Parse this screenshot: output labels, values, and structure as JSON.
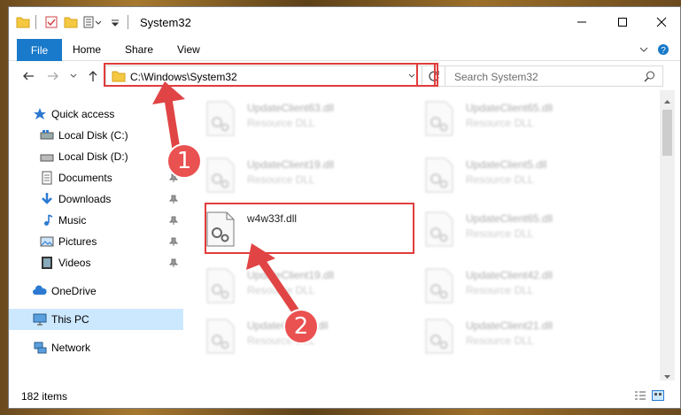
{
  "window": {
    "title": "System32",
    "minimize_icon": "minimize-icon",
    "maximize_icon": "maximize-icon",
    "close_icon": "close-icon"
  },
  "ribbon": {
    "tabs": [
      "File",
      "Home",
      "Share",
      "View"
    ],
    "collapse_icon": "chevron-down-icon",
    "help_icon": "help-icon"
  },
  "address": {
    "path": "C:\\Windows\\System32",
    "dropdown_icon": "chevron-down-icon",
    "refresh_icon": "refresh-icon"
  },
  "search": {
    "placeholder": "Search System32",
    "icon": "search-icon"
  },
  "nav": {
    "items": [
      {
        "label": "Quick access",
        "icon": "star-icon",
        "pinned": false
      },
      {
        "label": "Local Disk (C:)",
        "icon": "drive-icon",
        "pinned": false
      },
      {
        "label": "Local Disk (D:)",
        "icon": "drive-icon",
        "pinned": false
      },
      {
        "label": "Documents",
        "icon": "documents-icon",
        "pinned": true
      },
      {
        "label": "Downloads",
        "icon": "download-icon",
        "pinned": true
      },
      {
        "label": "Music",
        "icon": "music-icon",
        "pinned": true
      },
      {
        "label": "Pictures",
        "icon": "pictures-icon",
        "pinned": true
      },
      {
        "label": "Videos",
        "icon": "videos-icon",
        "pinned": true
      },
      {
        "label": "OneDrive",
        "icon": "cloud-icon",
        "pinned": false
      },
      {
        "label": "This PC",
        "icon": "computer-icon",
        "pinned": false,
        "selected": true
      },
      {
        "label": "Network",
        "icon": "network-icon",
        "pinned": false
      }
    ]
  },
  "files": [
    {
      "name": "UpdateClient63.dll",
      "type": "Resource DLL"
    },
    {
      "name": "UpdateClient65.dll",
      "type": "Resource DLL"
    },
    {
      "name": "UpdateClient19.dll",
      "type": "Resource DLL"
    },
    {
      "name": "UpdateClient5.dll",
      "type": "Resource DLL"
    },
    {
      "name": "w4w33f.dll",
      "type": ""
    },
    {
      "name": "UpdateClient65.dll",
      "type": "Resource DLL"
    },
    {
      "name": "UpdateClient19.dll",
      "type": "Resource DLL"
    },
    {
      "name": "UpdateClient42.dll",
      "type": "Resource DLL"
    },
    {
      "name": "UpdateClient5.dll",
      "type": "Resource DLL"
    },
    {
      "name": "UpdateClient21.dll",
      "type": "Resource DLL"
    }
  ],
  "status": {
    "item_count": "182 items"
  },
  "annotations": {
    "step1": "1",
    "step2": "2",
    "color": "#e13c3c"
  }
}
